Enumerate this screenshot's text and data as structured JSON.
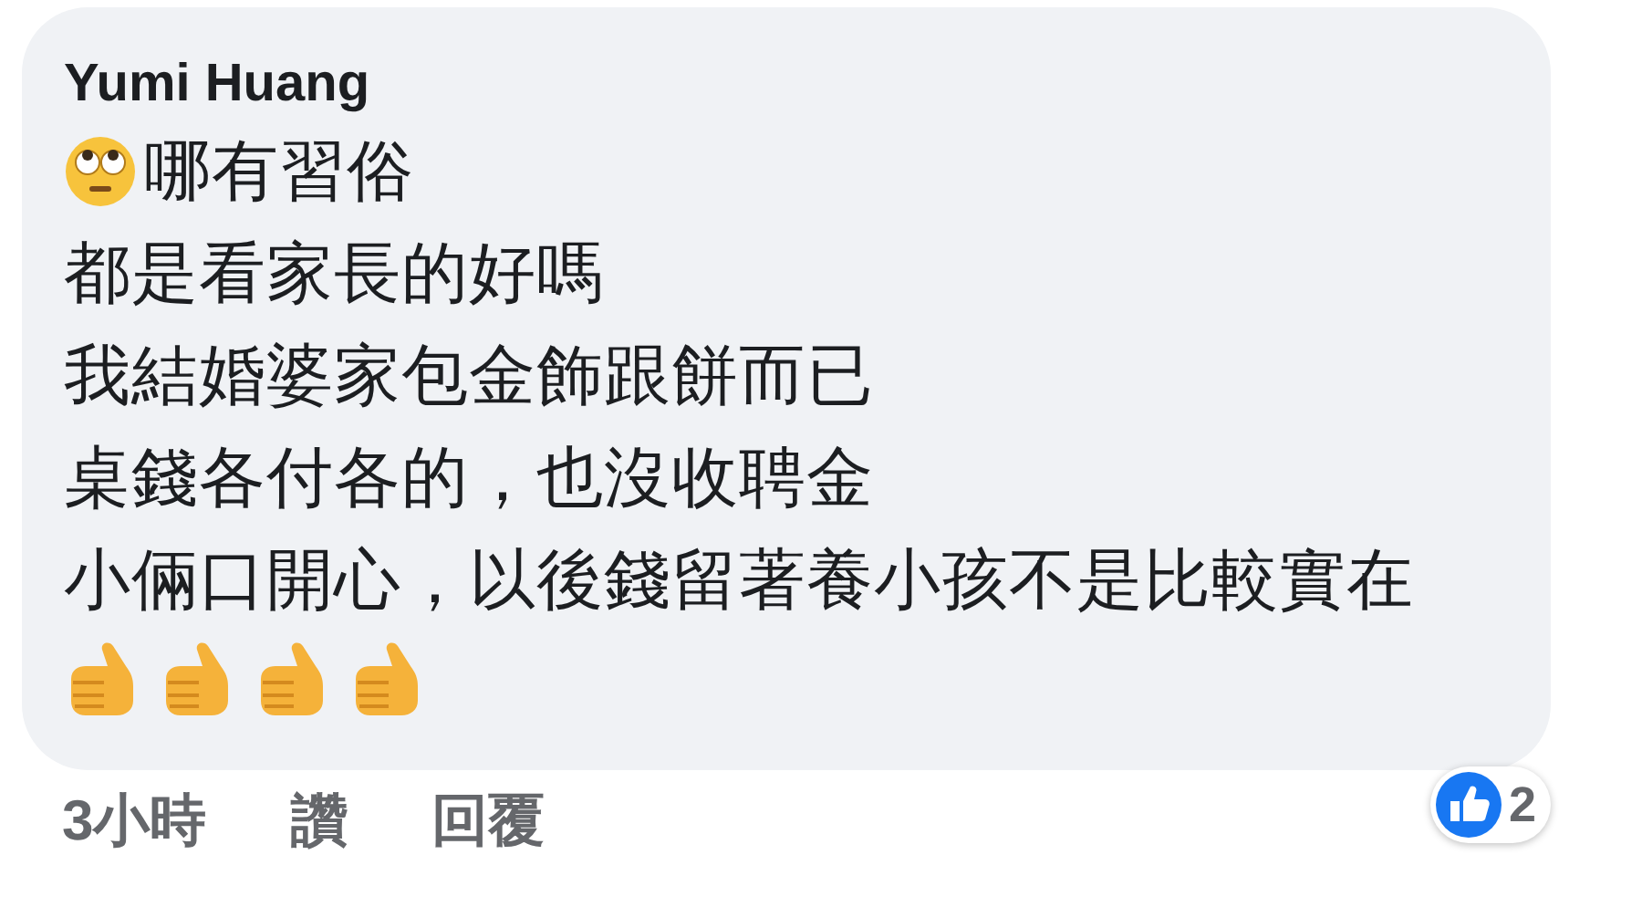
{
  "comment": {
    "author": "Yumi Huang",
    "lines": [
      "哪有習俗",
      "都是看家長的好嗎",
      "我結婚婆家包金飾跟餅而已",
      "桌錢各付各的，也沒收聘金",
      "小倆口開心，以後錢留著養小孩不是比較實在"
    ],
    "reaction_count": "2"
  },
  "actions": [
    "3小時",
    "讚",
    "回覆"
  ]
}
